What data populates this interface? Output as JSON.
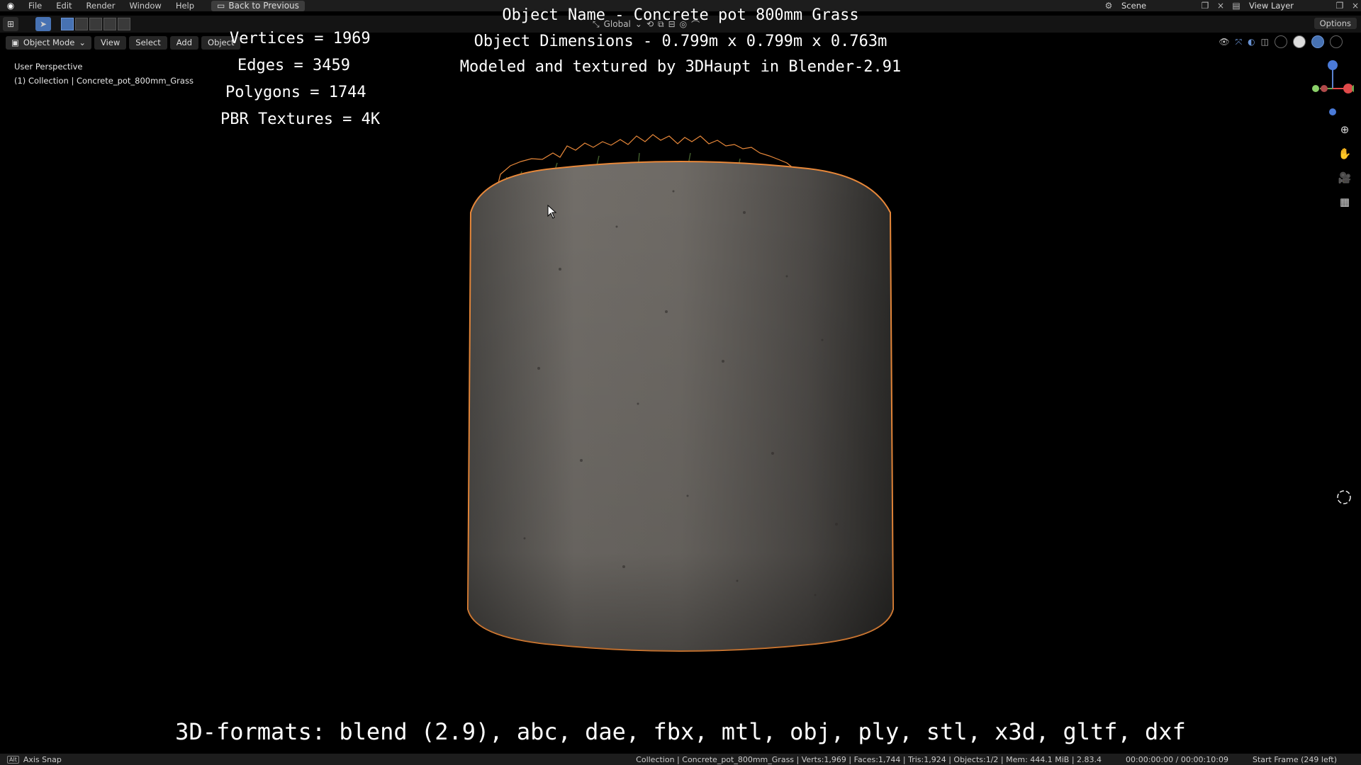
{
  "menubar": {
    "items": [
      "File",
      "Edit",
      "Render",
      "Window",
      "Help"
    ],
    "back_label": "Back to Previous",
    "scene": "Scene",
    "view_layer": "View Layer"
  },
  "toolbar": {
    "transform_orientation": "Global",
    "options_label": "Options"
  },
  "viewport_header": {
    "mode": "Object Mode",
    "menus": [
      "View",
      "Select",
      "Add",
      "Object"
    ]
  },
  "viewport_info": {
    "perspective": "User Perspective",
    "collection": "(1) Collection | Concrete_pot_800mm_Grass"
  },
  "stats_overlay": {
    "vertices": "Vertices = 1969",
    "edges": "Edges = 3459",
    "polygons": "Polygons = 1744",
    "textures": "PBR Textures = 4K"
  },
  "title_overlay": {
    "object_name": "Object Name - Concrete pot 800mm Grass",
    "dimensions": "Object Dimensions -  0.799m x 0.799m x 0.763m",
    "credits": "Modeled and textured by 3DHaupt in Blender-2.91"
  },
  "formats_line": "3D-formats: blend (2.9), abc, dae, fbx, mtl, obj, ply, stl, x3d, gltf, dxf",
  "statusbar": {
    "left": "Axis Snap",
    "stats": "Collection | Concrete_pot_800mm_Grass | Verts:1,969 | Faces:1,744 | Tris:1,924 | Objects:1/2 | Mem: 444.1 MiB | 2.83.4",
    "time": "00:00:00:00 / 00:00:10:09",
    "frame": "Start Frame (249 left)"
  },
  "colors": {
    "selection_outline": "#e8883a",
    "concrete": "#6f6b66",
    "accent": "#4772b3"
  }
}
